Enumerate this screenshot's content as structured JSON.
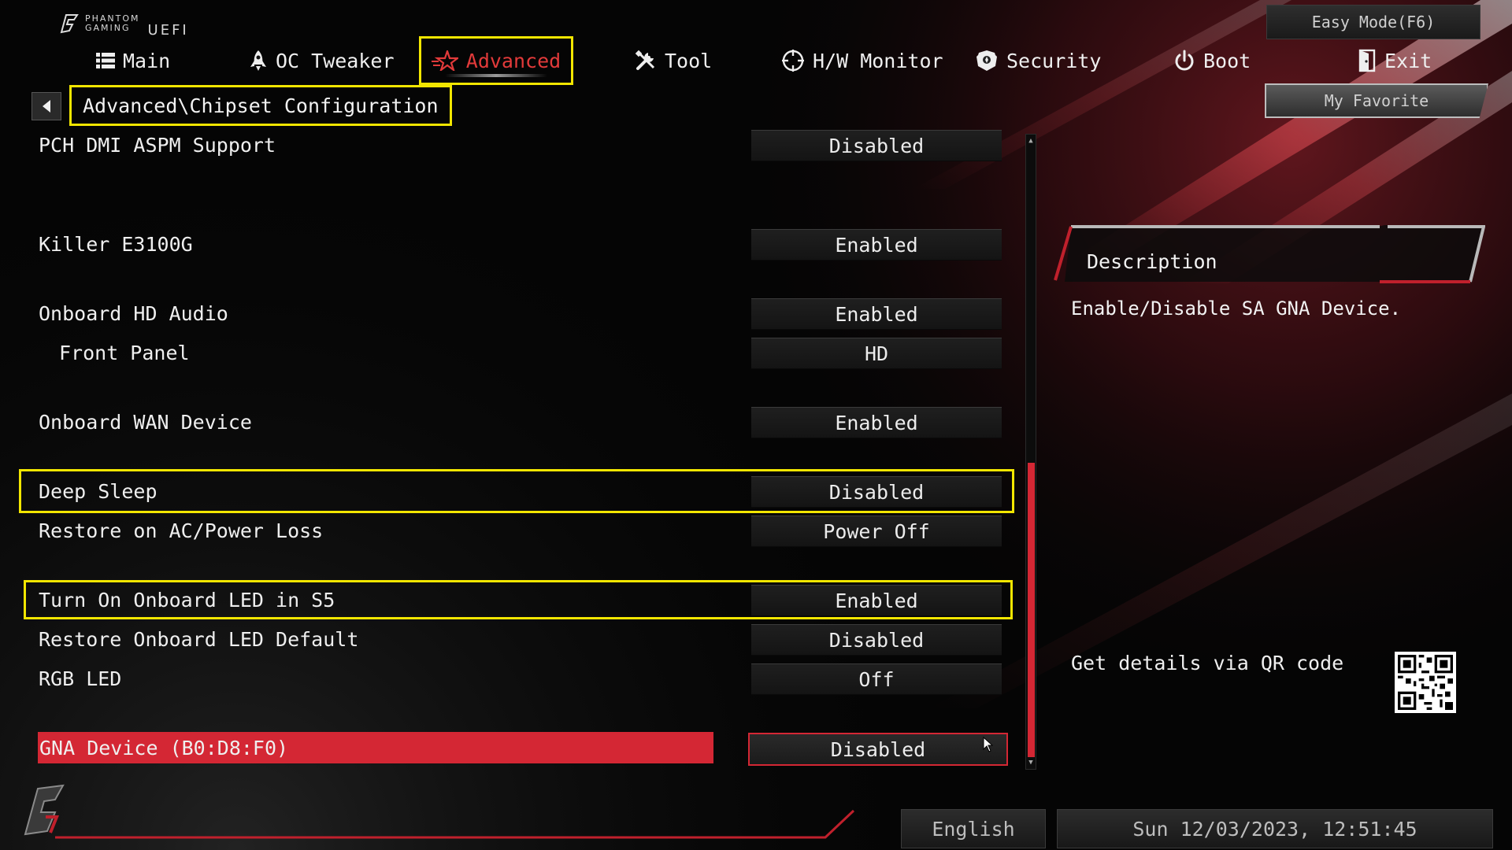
{
  "brand": {
    "line1": "PHANTOM",
    "line2": "GAMING",
    "uefi": "UEFI"
  },
  "easy_mode_label": "Easy Mode(F6)",
  "nav": {
    "tabs": [
      {
        "label": "Main",
        "icon": "list-icon"
      },
      {
        "label": "OC Tweaker",
        "icon": "rocket-icon"
      },
      {
        "label": "Advanced",
        "icon": "star-icon",
        "active": true
      },
      {
        "label": "Tool",
        "icon": "tools-icon"
      },
      {
        "label": "H/W Monitor",
        "icon": "crosshair-icon"
      },
      {
        "label": "Security",
        "icon": "shield-icon"
      },
      {
        "label": "Boot",
        "icon": "power-icon"
      },
      {
        "label": "Exit",
        "icon": "exit-door-icon"
      }
    ]
  },
  "breadcrumb": "Advanced\\Chipset Configuration",
  "my_favorite": "My Favorite",
  "settings": [
    {
      "label": "PCH DMI ASPM Support",
      "value": "Disabled"
    },
    {
      "label": "Killer E3100G",
      "value": "Enabled"
    },
    {
      "label": "Onboard HD Audio",
      "value": "Enabled"
    },
    {
      "label": "Front Panel",
      "value": "HD"
    },
    {
      "label": "Onboard WAN Device",
      "value": "Enabled"
    },
    {
      "label": "Deep Sleep",
      "value": "Disabled"
    },
    {
      "label": "Restore on AC/Power Loss",
      "value": "Power Off"
    },
    {
      "label": "Turn On Onboard LED in S5",
      "value": "Enabled"
    },
    {
      "label": "Restore Onboard LED Default",
      "value": "Disabled"
    },
    {
      "label": "RGB LED",
      "value": "Off"
    },
    {
      "label": "GNA Device (B0:D8:F0)",
      "value": "Disabled"
    }
  ],
  "description": {
    "title": "Description",
    "text": "Enable/Disable SA GNA Device.",
    "qr_label": "Get details via QR code"
  },
  "footer": {
    "language": "English",
    "datetime": "Sun 12/03/2023, 12:51:45"
  },
  "colors": {
    "accent_red": "#d42734",
    "highlight_yellow": "#f2e600"
  }
}
